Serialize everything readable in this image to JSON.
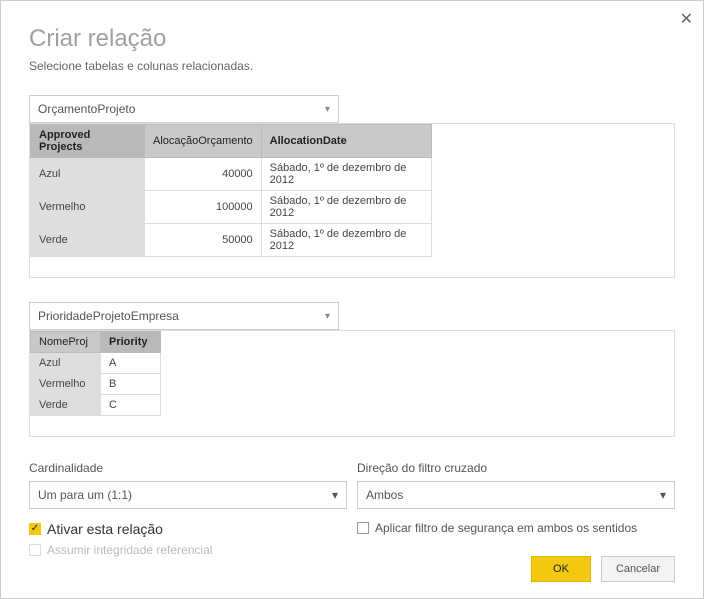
{
  "dialog": {
    "title": "Criar relação",
    "subtitle": "Selecione tabelas e colunas relacionadas.",
    "close_glyph": "✕"
  },
  "table1": {
    "select": "OrçamentoProjeto",
    "headers": [
      "Approved Projects",
      "AlocaçãoOrçamento",
      "AllocationDate"
    ],
    "rows": [
      {
        "c0": "Azul",
        "c1": "40000",
        "c2": "Sábado, 1º de dezembro de 2012"
      },
      {
        "c0": "Vermelho",
        "c1": "100000",
        "c2": "Sábado, 1º de dezembro de 2012"
      },
      {
        "c0": "Verde",
        "c1": "50000",
        "c2": "Sábado, 1º de dezembro de 2012"
      }
    ]
  },
  "table2": {
    "select": "PrioridadeProjetoEmpresa",
    "headers": [
      "NomeProj",
      "Priority"
    ],
    "rows": [
      {
        "c0": "Azul",
        "c1": "A"
      },
      {
        "c0": "Vermelho",
        "c1": "B"
      },
      {
        "c0": "Verde",
        "c1": "C"
      }
    ]
  },
  "options": {
    "cardinality_label": "Cardinalidade",
    "cardinality_value": "Um para um (1:1)",
    "crossfilter_label": "Direção do filtro cruzado",
    "crossfilter_value": "Ambos",
    "activate_label": "Ativar esta relação",
    "assume_integrity_label": "Assumir integridade referencial",
    "security_both_label": "Aplicar filtro de segurança em ambos os sentidos",
    "check_glyph": "✓"
  },
  "buttons": {
    "ok": "OK",
    "cancel": "Cancelar"
  },
  "caret": "▾"
}
